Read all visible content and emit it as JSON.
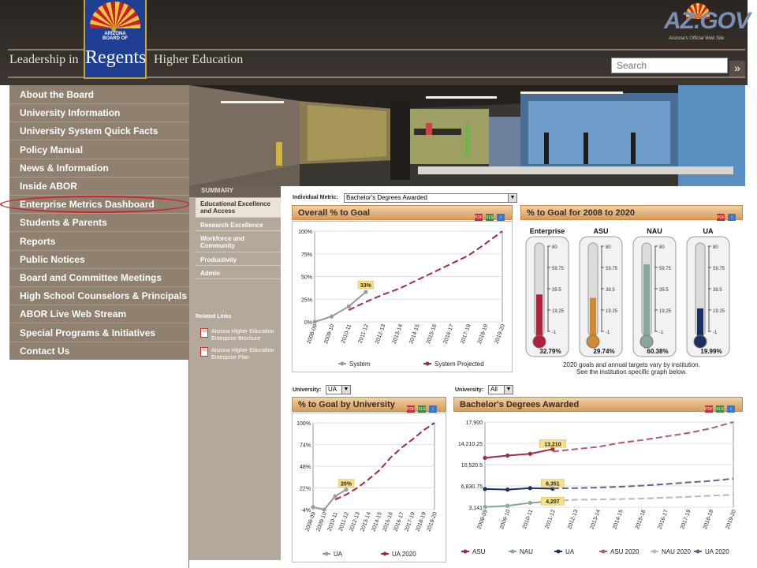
{
  "header": {
    "tagline_left": "Leadership in",
    "tagline_right": "Higher Education",
    "logo_line1": "ARIZONA",
    "logo_line2": "BOARD OF",
    "logo_name": "Regents",
    "azgov_logo": "AZ.GOV",
    "azgov_sub": "Arizona's Official Web Site",
    "search_placeholder": "Search"
  },
  "nav": {
    "items": [
      {
        "label": "About the Board"
      },
      {
        "label": "University Information"
      },
      {
        "label": "University System Quick Facts"
      },
      {
        "label": "Policy Manual"
      },
      {
        "label": "News & Information"
      },
      {
        "label": "Inside ABOR"
      },
      {
        "label": "Enterprise Metrics Dashboard"
      },
      {
        "label": "Students & Parents"
      },
      {
        "label": "Reports"
      },
      {
        "label": "Public Notices"
      },
      {
        "label": "Board and Committee Meetings"
      },
      {
        "label": "High School Counselors & Principals"
      },
      {
        "label": "ABOR Live Web Stream"
      },
      {
        "label": "Special Programs & Initiatives"
      },
      {
        "label": "Contact Us"
      }
    ],
    "highlight_color": "#d0202a"
  },
  "summary": {
    "header": "SUMMARY",
    "items": [
      {
        "label": "Educational Excellence and Access"
      },
      {
        "label": "Research Excellence"
      },
      {
        "label": "Workforce and Community"
      },
      {
        "label": "Productivity"
      },
      {
        "label": "Admin"
      }
    ],
    "related_title": "Related Links",
    "related": [
      {
        "label": "Arizona Higher Education Enterprise Brochure"
      },
      {
        "label": "Arizona Higher Education Enterprise Plan"
      }
    ]
  },
  "metric_select": {
    "label": "Individual Metric:",
    "value": "Bachelor's Degrees Awarded"
  },
  "panels": {
    "overall": {
      "title": "Overall % to Goal"
    },
    "goal_2020": {
      "title": "% to Goal for 2008 to 2020",
      "note1": "2020 goals and annual targets vary by institution.",
      "note2": "See the institution specific graph below."
    },
    "by_university": {
      "title": "% to Goal by University"
    },
    "bachelors": {
      "title": "Bachelor's Degrees Awarded"
    }
  },
  "university_select_left": {
    "label": "University:",
    "value": "UA"
  },
  "university_select_right": {
    "label": "University:",
    "value": "All"
  },
  "icons": {
    "pdf": "PDF",
    "xls": "XLS",
    "info": "i"
  },
  "chart_data": [
    {
      "type": "line",
      "title": "Overall % to Goal",
      "categories": [
        "2008-09",
        "2009-10",
        "2010-11",
        "2011-12",
        "2012-13",
        "2013-14",
        "2014-15",
        "2015-16",
        "2016-17",
        "2017-19",
        "2018-19",
        "2019-20"
      ],
      "y_ticks": [
        "100%",
        "75%",
        "50%",
        "25%",
        "0%"
      ],
      "ylim": [
        0,
        100
      ],
      "series": [
        {
          "name": "System",
          "color": "#9a9a9a",
          "values": [
            0,
            6,
            17,
            33,
            null,
            null,
            null,
            null,
            null,
            null,
            null,
            null
          ]
        },
        {
          "name": "System Projected",
          "color": "#a0294a",
          "dashed": true,
          "values": [
            null,
            null,
            13,
            22,
            30,
            37,
            46,
            55,
            64,
            73,
            86,
            100
          ]
        }
      ],
      "annotation": "33%"
    },
    {
      "type": "thermometer",
      "title": "% to Goal for 2008 to 2020",
      "scale_ticks": [
        "80",
        "59.75",
        "39.5",
        "19.25",
        "-1"
      ],
      "items": [
        {
          "name": "Enterprise",
          "value": 32.79,
          "label": "32.79%",
          "color": "#b21f3d"
        },
        {
          "name": "ASU",
          "value": 29.74,
          "label": "29.74%",
          "color": "#cf8a33"
        },
        {
          "name": "NAU",
          "value": 60.38,
          "label": "60.38%",
          "color": "#8aa89a"
        },
        {
          "name": "UA",
          "value": 19.99,
          "label": "19.99%",
          "color": "#1c2f63"
        }
      ]
    },
    {
      "type": "line",
      "title": "% to Goal by University",
      "categories": [
        "2008-09",
        "2009-10",
        "2010-11",
        "2011-12",
        "2012-13",
        "2013-14",
        "2014-15",
        "2015-16",
        "2016-17",
        "2017-19",
        "2018-19",
        "2019-20"
      ],
      "y_ticks": [
        "100%",
        "74%",
        "48%",
        "22%",
        "-4%"
      ],
      "ylim": [
        -4,
        100
      ],
      "series": [
        {
          "name": "UA",
          "color": "#9a9a9a",
          "values": [
            -1,
            -4,
            12,
            20,
            null,
            null,
            null,
            null,
            null,
            null,
            null,
            null
          ]
        },
        {
          "name": "UA 2020",
          "color": "#a0294a",
          "dashed": true,
          "values": [
            null,
            null,
            8,
            14,
            22,
            32,
            43,
            58,
            70,
            80,
            91,
            100
          ]
        }
      ],
      "annotation": "20%"
    },
    {
      "type": "line",
      "title": "Bachelor's Degrees Awarded",
      "categories": [
        "2008-09",
        "2009-10",
        "2010-11",
        "2011-12",
        "2012-13",
        "2013-14",
        "2014-15",
        "2015-16",
        "2016-17",
        "2017-19",
        "2018-19",
        "2019-20"
      ],
      "y_ticks": [
        "17,900",
        "14,210.25",
        "10,520.5",
        "6,830.75",
        "3,141"
      ],
      "ylim": [
        3141,
        17900
      ],
      "series": [
        {
          "name": "ASU",
          "color": "#a0294a",
          "values": [
            11700,
            12100,
            12400,
            13210,
            null,
            null,
            null,
            null,
            null,
            null,
            null,
            null
          ]
        },
        {
          "name": "NAU",
          "color": "#8aa89a",
          "values": [
            3200,
            3400,
            3900,
            4207,
            null,
            null,
            null,
            null,
            null,
            null,
            null,
            null
          ]
        },
        {
          "name": "UA",
          "color": "#1c2f63",
          "values": [
            6300,
            6200,
            6450,
            6351,
            null,
            null,
            null,
            null,
            null,
            null,
            null,
            null
          ]
        },
        {
          "name": "ASU 2020",
          "color": "#b5557a",
          "dashed": true,
          "values": [
            null,
            null,
            null,
            12800,
            13200,
            13600,
            14300,
            14800,
            15400,
            16000,
            16800,
            17900
          ]
        },
        {
          "name": "NAU 2020",
          "color": "#b8b8b8",
          "dashed": true,
          "values": [
            null,
            null,
            null,
            4207,
            4450,
            4500,
            4550,
            4650,
            4800,
            4950,
            5150,
            5300
          ]
        },
        {
          "name": "UA 2020",
          "color": "#5a6790",
          "dashed": true,
          "values": [
            null,
            null,
            null,
            6400,
            6450,
            6550,
            6700,
            6900,
            7150,
            7450,
            7700,
            8100
          ]
        }
      ],
      "annotations": [
        "13,210",
        "6,351",
        "4,207"
      ]
    }
  ]
}
